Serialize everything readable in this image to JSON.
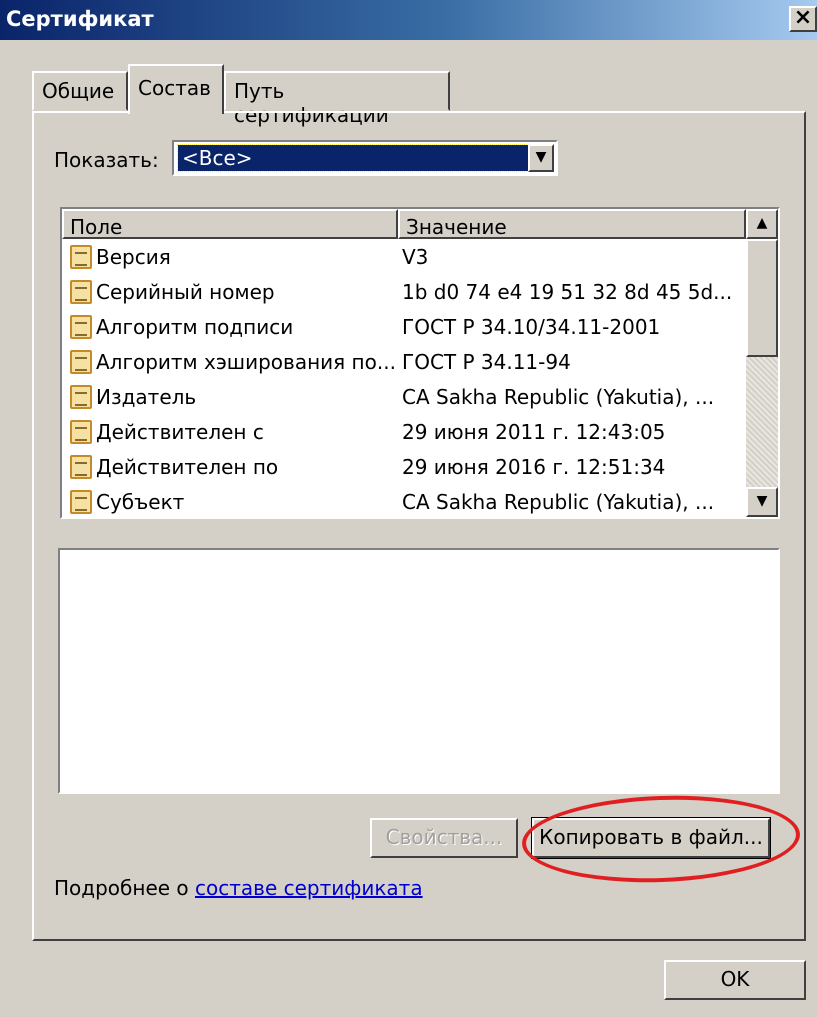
{
  "window": {
    "title": "Сертификат",
    "close_glyph": "×"
  },
  "tabs": [
    {
      "label": "Общие"
    },
    {
      "label": "Состав"
    },
    {
      "label": "Путь сертификации"
    }
  ],
  "show": {
    "label": "Показать:",
    "selected": "<Все>",
    "dropdown_icon": "chevron-down-icon"
  },
  "list": {
    "columns": {
      "field": "Поле",
      "value": "Значение"
    },
    "rows": [
      {
        "field": "Версия",
        "value": "V3"
      },
      {
        "field": "Серийный номер",
        "value": "1b d0 74 e4 19 51 32 8d 45 5d..."
      },
      {
        "field": "Алгоритм подписи",
        "value": "ГОСТ Р 34.10/34.11-2001"
      },
      {
        "field": "Алгоритм хэширования по...",
        "value": "ГОСТ Р 34.11-94"
      },
      {
        "field": "Издатель",
        "value": "CA Sakha Republic (Yakutia), ..."
      },
      {
        "field": "Действителен с",
        "value": "29 июня 2011 г. 12:43:05"
      },
      {
        "field": "Действителен по",
        "value": "29 июня 2016 г. 12:51:34"
      },
      {
        "field": "Субъект",
        "value": "CA Sakha Republic (Yakutia), ..."
      }
    ]
  },
  "buttons": {
    "properties": "Свойства...",
    "copy_to_file": "Копировать в файл...",
    "ok": "OK"
  },
  "more_info": {
    "text": "Подробнее о ",
    "link": "составе сертификата"
  },
  "colors": {
    "title_bar": "#0a246a",
    "selection": "#0a246a",
    "annotation": "#e02020",
    "dialog_bg": "#d4d0c8"
  }
}
